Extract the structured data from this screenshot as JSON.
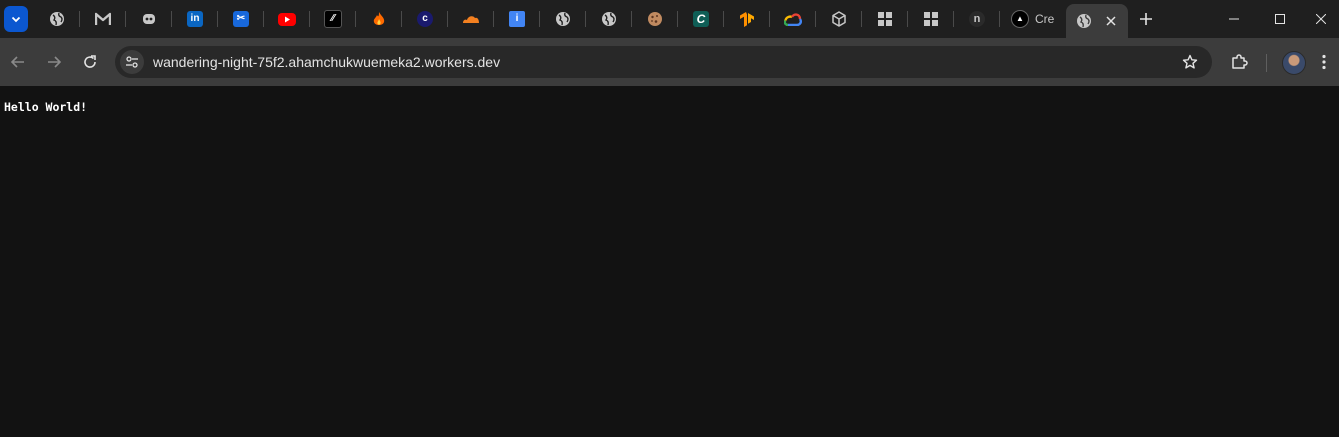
{
  "browser": {
    "tabs": [
      {
        "icon": "globe-icon",
        "color": "#c7c7c7"
      },
      {
        "icon": "gmail-icon",
        "color": "#c7c7c7"
      },
      {
        "icon": "bot-icon",
        "color": "#c7c7c7"
      },
      {
        "icon": "linkedin-icon",
        "color": "#0a66c2"
      },
      {
        "icon": "confluence-icon",
        "color": "#1868db"
      },
      {
        "icon": "youtube-icon",
        "color": "#ff0000"
      },
      {
        "icon": "slash-app-icon",
        "color": "#000000"
      },
      {
        "icon": "fire-icon",
        "color": "#ff6a00"
      },
      {
        "icon": "c-logo-icon",
        "color": "#1a1a6e"
      },
      {
        "icon": "cloudflare-icon",
        "color": "#f38020"
      },
      {
        "icon": "info-icon",
        "color": "#4285f4"
      },
      {
        "icon": "globe-icon",
        "color": "#c7c7c7"
      },
      {
        "icon": "globe-icon",
        "color": "#c7c7c7"
      },
      {
        "icon": "cookie-icon",
        "color": "#c08a60"
      },
      {
        "icon": "c-teal-icon",
        "color": "#0f5e56"
      },
      {
        "icon": "tensorflow-icon",
        "color": "#ff8f00"
      },
      {
        "icon": "google-cloud-icon",
        "color": "#4285f4"
      },
      {
        "icon": "box-icon",
        "color": "#c7c7c7"
      },
      {
        "icon": "grid-icon",
        "color": "#c7c7c7"
      },
      {
        "icon": "grid-icon",
        "color": "#c7c7c7"
      },
      {
        "icon": "n-logo-icon",
        "color": "#2a2a2a"
      },
      {
        "icon": "triangle-logo-icon",
        "color": "#000000",
        "title": "Cre"
      }
    ],
    "active_tab": {
      "icon": "globe-icon"
    },
    "address_bar": {
      "url": "wandering-night-75f2.ahamchukwuemeka2.workers.dev"
    }
  },
  "page": {
    "text": "Hello World!"
  }
}
